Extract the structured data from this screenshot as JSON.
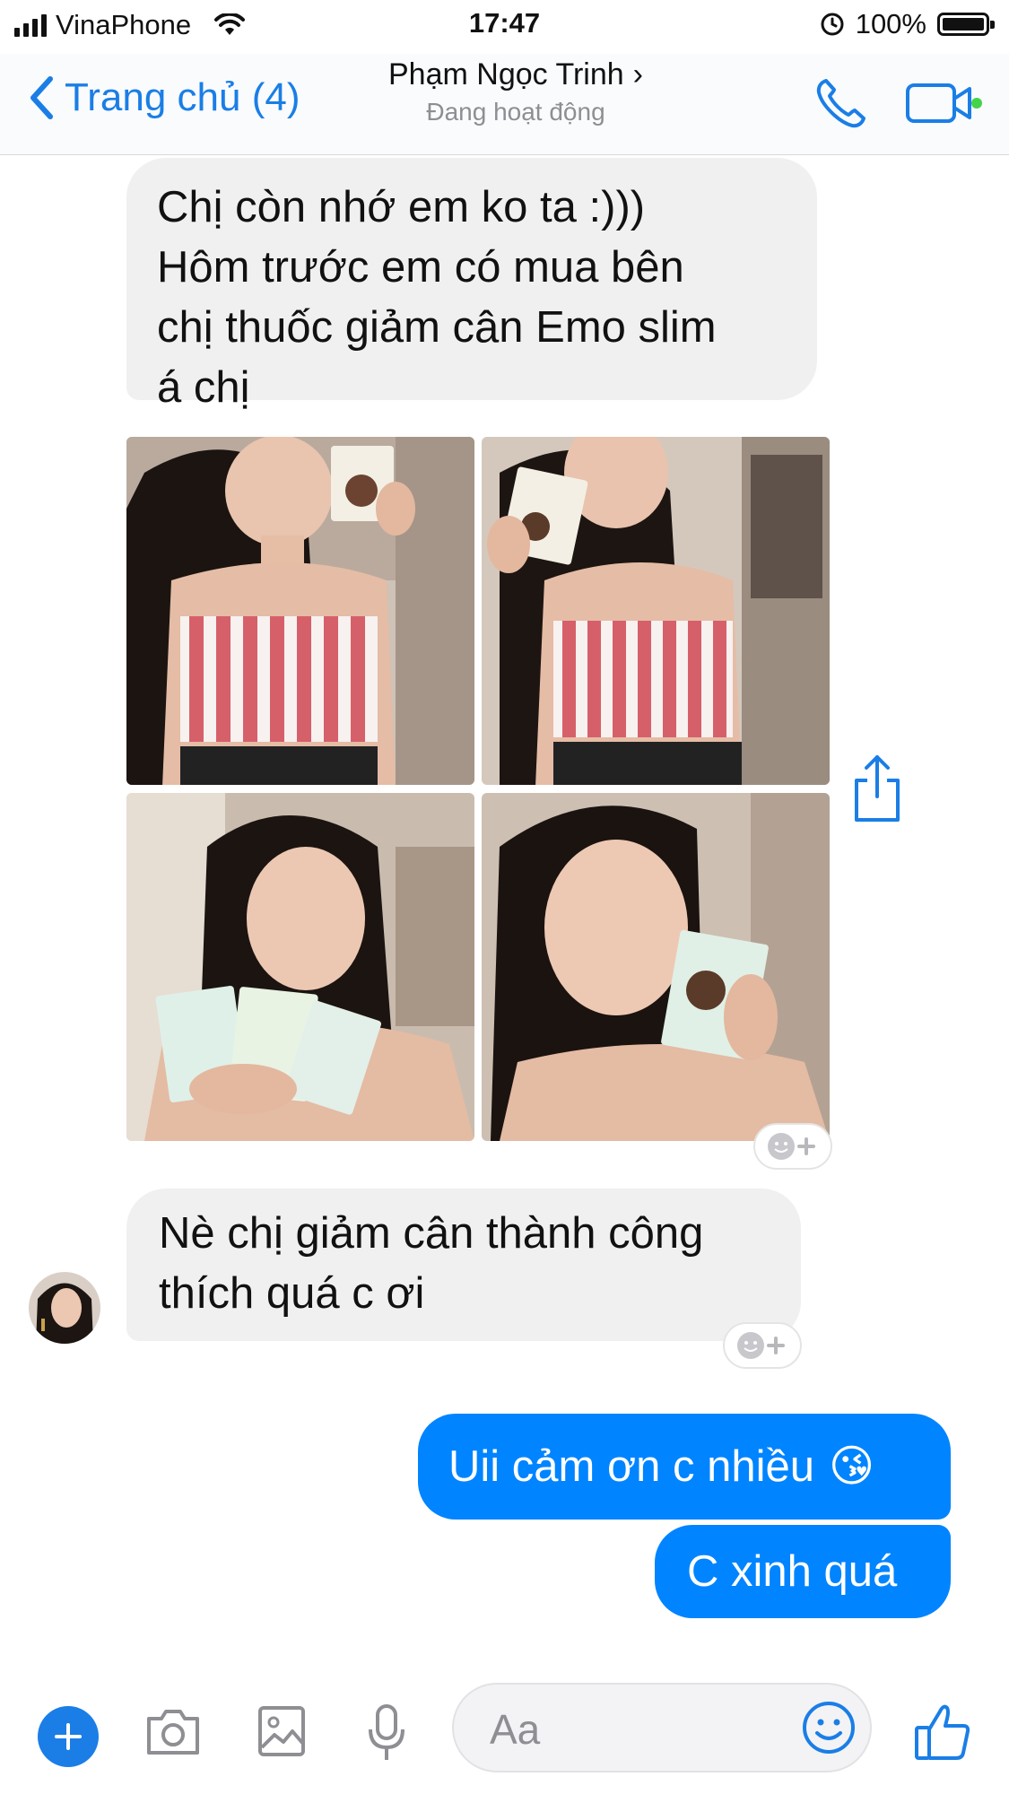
{
  "status_bar": {
    "carrier": "VinaPhone",
    "time": "17:47",
    "battery_percent": "100%"
  },
  "header": {
    "back_label": "Trang chủ (4)",
    "contact_name": "Phạm Ngọc Trinh",
    "contact_status": "Đang hoạt động"
  },
  "messages": {
    "incoming_1": "Chị còn nhớ em ko ta :)))\nHôm trước em có mua bên\nchị thuốc giảm cân Emo slim\ná chị",
    "incoming_2": "Nè chị giảm cân thành công\nthích quá c ơi",
    "outgoing_1": "Uii cảm ơn c nhiều",
    "outgoing_1_emoji": "😘",
    "outgoing_2": "C xinh quá"
  },
  "composer": {
    "placeholder": "Aa"
  },
  "colors": {
    "accent": "#1a7ee6",
    "outgoing_bubble": "#0084ff",
    "incoming_bubble": "#f0f0f0",
    "active_dot": "#44d34a"
  },
  "icons": [
    "wifi-icon",
    "alarm-lock-icon",
    "back-chevron-icon",
    "phone-icon",
    "video-icon",
    "share-icon",
    "add-reaction-icon",
    "plus-icon",
    "camera-icon",
    "gallery-icon",
    "microphone-icon",
    "emoji-icon",
    "thumbs-up-icon"
  ]
}
